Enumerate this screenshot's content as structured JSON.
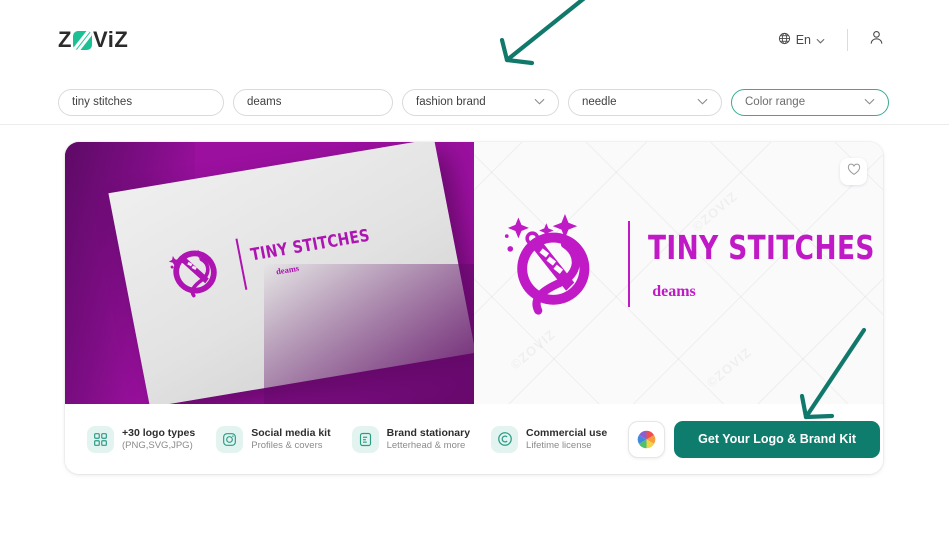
{
  "header": {
    "brand_name": "ZOVIZ",
    "brand_z": "Z",
    "brand_rest": "ViZ",
    "brand_mark_color": "#1bc194",
    "language": "En",
    "globe_icon": "globe-icon",
    "chevron_icon": "chevron-down-icon",
    "account_icon": "user-icon"
  },
  "filters": [
    {
      "name": "brand-name-input",
      "value": "tiny stitches",
      "type": "text"
    },
    {
      "name": "slogan-input",
      "value": "deams",
      "type": "text"
    },
    {
      "name": "industry-select",
      "value": "fashion brand",
      "type": "select"
    },
    {
      "name": "keyword-select",
      "value": "needle",
      "type": "select"
    },
    {
      "name": "color-range-select",
      "value": "Color range",
      "type": "select",
      "active": true
    }
  ],
  "preview": {
    "favorite_icon": "heart-icon",
    "watermark": "©ZOVIZ",
    "logo": {
      "name": "TINY STITCHES",
      "tagline": "deams",
      "color": "#c019c6",
      "mark": "needle-thread-sparkle-icon"
    },
    "mockup": {
      "background": "#9c10a0",
      "card_type": "business-card",
      "name": "TINY STITCHES",
      "tagline": "deams"
    }
  },
  "features": [
    {
      "icon": "grid-icon",
      "title": "+30 logo types",
      "subtitle": "(PNG,SVG,JPG)"
    },
    {
      "icon": "camera-icon",
      "title": "Social media kit",
      "subtitle": "Profiles & covers"
    },
    {
      "icon": "document-icon",
      "title": "Brand stationary",
      "subtitle": "Letterhead & more"
    },
    {
      "icon": "copyright-icon",
      "title": "Commercial use",
      "subtitle": "Lifetime license"
    }
  ],
  "cta": {
    "palette_icon": "color-wheel-icon",
    "button_label": "Get Your Logo & Brand Kit",
    "button_color": "#0f7d6d"
  },
  "annotations": {
    "color": "#11796b",
    "arrow_1_target": "industry-select",
    "arrow_2_target": "get-logo-button"
  }
}
